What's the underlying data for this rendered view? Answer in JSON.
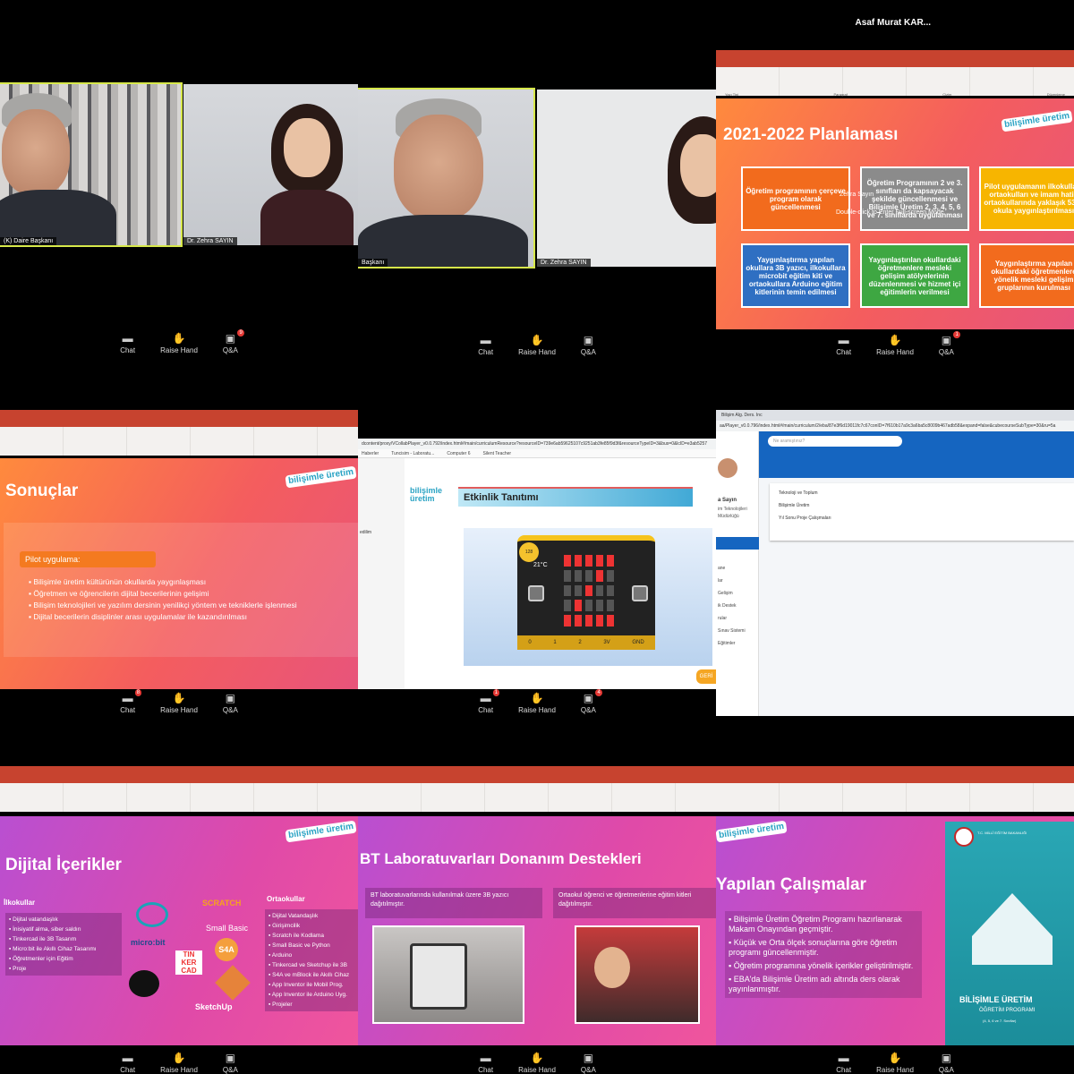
{
  "host_name": "Asaf Murat KAR...",
  "controls": {
    "chat": "Chat",
    "raise_hand": "Raise Hand",
    "qa": "Q&A"
  },
  "badges": {
    "c1_qa": "9",
    "c3_qa": "1",
    "c4_chat": "8",
    "c5_chat": "1",
    "c5_qa": "4"
  },
  "tiles": {
    "daire": "(K) Daire Başkanı",
    "daire2": "Başkanı",
    "zehra": "Dr. Zehra SAYIN"
  },
  "ribbon": {
    "section1": "Yazı Tipi",
    "section2": "Paragraf",
    "section3": "Çizim",
    "section4": "Düzenleme"
  },
  "slide3": {
    "title": "2021-2022 Planlaması",
    "boxes": [
      "Öğretim programının çerçeve program olarak güncellenmesi",
      "Öğretim Programının 2 ve 3. sınıfları da kapsayacak şekilde güncellenmesi ve Bilişimle Üretim 2, 3, 4, 5, 6 ve 7. sınıflarda uygulanması",
      "Pilot uygulamanın ilkokulları, ortaokulları ve imam hatip ortaokullarında yaklaşık 5300 okula yaygınlaştırılması",
      "Yaygınlaştırma yapılan okullara 3B yazıcı, ilkokullara microbit eğitim kiti ve ortaokullara Arduino eğitim kitlerinin temin edilmesi",
      "Yaygınlaştırılan okullardaki öğretmenlere mesleki gelişim atölyelerinin düzenlenmesi ve hizmet içi eğitimlerin verilmesi",
      "Yaygınlaştırma yapılan okullardaki öğretmenlere yönelik mesleki gelişim gruplarının kurulması"
    ],
    "overlay": "Zehra Sayın",
    "overlay2": "Double-click to Enter Full-screen Mode"
  },
  "slide4": {
    "title": "Sonuçlar",
    "pill": "Pilot uygulama:",
    "bullets": [
      "Bilişimle üretim kültürünün okullarda yaygınlaşması",
      "Öğretmen ve öğrencilerin dijital becerilerinin gelişimi",
      "Bilişim teknolojileri ve yazılım dersinin yenilikçi yöntem ve tekniklerle işlenmesi",
      "Dijital becerilerin disiplinler arası uygulamalar ile kazandırılması"
    ]
  },
  "slide5": {
    "address": "dcontent/proxy/VCollabPlayer_v0.0.792/index.html#/main/curriculumResource?resourceID=739e6ab59625107c9251ab3fe85f9d3f&resourceTypeID=3&bus=0&lcID=e3ab5257",
    "bookmarks": [
      "Haberler",
      "Tuncisim - Laboratu...",
      "Computer 6",
      "Silent Teacher"
    ],
    "header": "Etkinlik Tanıtımı",
    "side_label": "edilim",
    "geri": "GERİ",
    "temp": "21°C",
    "level": "128",
    "pins": [
      "0",
      "1",
      "2",
      "3V",
      "GND"
    ]
  },
  "slide6": {
    "tab": "Bilişim Alg. Ders. Inc",
    "address": "aa/Player_v0.0.796/index.html#/main/curriculum/2/eba/87e3f6d19011fc7c67conID=7f610b17a9c3a6ba5c8009b467adb58&expand=false&cubecourseSubType=30&ru=5a",
    "search": "Ne aramıştınız?",
    "name": "a Sayın",
    "org1": "im Teknolojileri",
    "org2": "Müdürlüğü",
    "menu": [
      "Teknoloji ve Toplum",
      "Bilişimle Üretim",
      "Yıl Sonu Proje Çalışmaları"
    ],
    "side": [
      "ane",
      "lar",
      "Gelişim",
      "ik Destek",
      "rular",
      "Sınav Sistemi",
      "Eğitimler"
    ]
  },
  "slide7": {
    "title": "Dijital İçerikler",
    "left_head": "İlkokullar",
    "left": [
      "Dijital vatandaşlık",
      "İnisiyatif alma, siber saldırı",
      "Tinkercad ile 3B Tasarım",
      "Micro:bit ile Akıllı Cihaz Tasarımı",
      "Öğretmenler için Eğitim",
      "Proje"
    ],
    "right_head": "Ortaokullar",
    "right": [
      "Dijital Vatandaşlık",
      "Girişimcilik",
      "Scratch ile Kodlama",
      "Small Basic ve Python",
      "Arduino",
      "Tinkercad ve Sketchup ile 3B",
      "S4A ve mBlock ile Akıllı Cihaz",
      "App Inventor ile Mobil Prog.",
      "App Inventor ile Arduino Uyg.",
      "Projeler"
    ],
    "logos": {
      "scratch": "SCRATCH",
      "microbit": "micro:bit",
      "smallbasic": "Small Basic",
      "tinker": "TIN KER CAD",
      "s4a": "S4A",
      "sketchup": "SketchUp"
    }
  },
  "slide8": {
    "title": "BT Laboratuvarları Donanım Destekleri",
    "left": "BT laboratuvarlarında kullanılmak üzere 3B yazıcı dağıtılmıştır.",
    "right": "Ortaokul öğrenci ve öğretmenlerine eğitim kitleri dağıtılmıştır."
  },
  "slide9": {
    "title": "Yapılan Çalışmalar",
    "bullets": [
      "Bilişimle Üretim Öğretim Programı hazırlanarak Makam Onayından geçmiştir.",
      "Küçük ve Orta ölçek sonuçlarına göre öğretim programı güncellenmiştir.",
      "Öğretim programına yönelik içerikler geliştirilmiştir.",
      "EBA'da Bilişimle Üretim adı altında ders olarak yayınlanmıştır."
    ],
    "book_title": "BİLİŞİMLE ÜRETİM",
    "book_sub": "ÖĞRETİM PROGRAMI",
    "book_sub2": "(4, 5, 6 ve 7. Sınıflar)",
    "ministry": "T.C. MİLLÎ EĞİTİM BAKANLIĞI"
  },
  "logo_text": "bilişimle üretim"
}
